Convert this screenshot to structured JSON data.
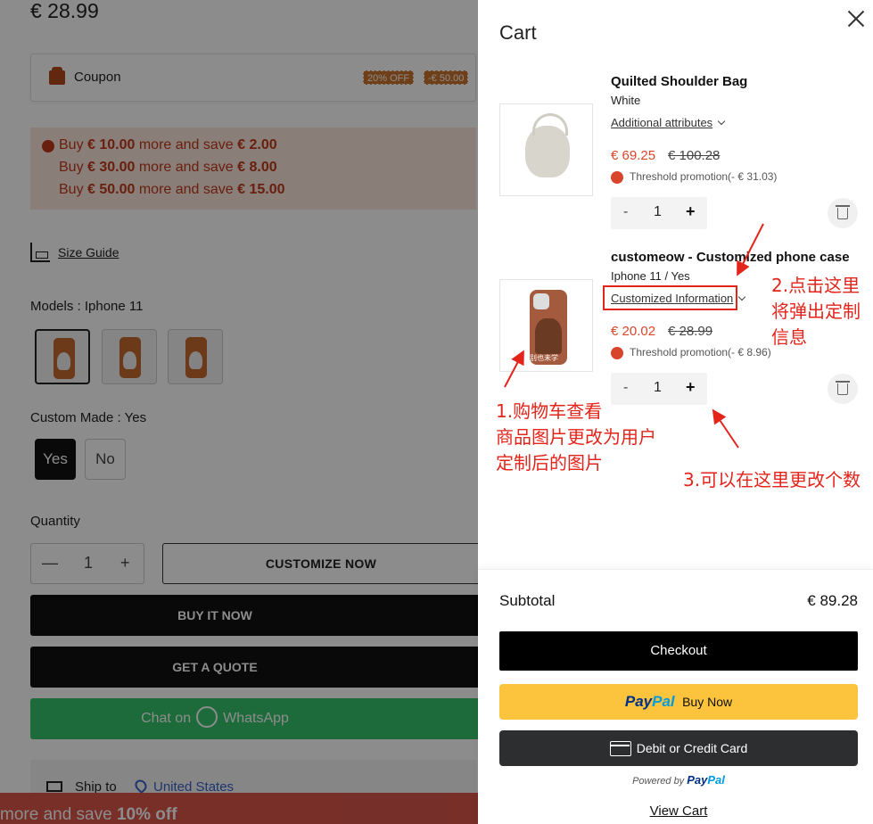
{
  "background_page": {
    "price": "€ 28.99",
    "coupon": {
      "label": "Coupon",
      "tags": [
        "20% OFF",
        "-€ 50.00"
      ]
    },
    "promotions": [
      {
        "pre": "Buy ",
        "amount": "€ 10.00",
        "mid": " more and save ",
        "save": "€ 2.00"
      },
      {
        "pre": "Buy ",
        "amount": "€ 30.00",
        "mid": " more and save ",
        "save": "€ 8.00"
      },
      {
        "pre": "Buy ",
        "amount": "€ 50.00",
        "mid": " more and save ",
        "save": "€ 15.00"
      }
    ],
    "size_guide": "Size Guide",
    "models_label": "Models : ",
    "models_value": "Iphone 11",
    "custom_made_label": "Custom Made : ",
    "custom_made_value": "Yes",
    "custom_options": [
      "Yes",
      "No"
    ],
    "quantity_label": "Quantity",
    "quantity_value": "1",
    "qty_minus": "—",
    "qty_plus": "+",
    "customize_button": "CUSTOMIZE NOW",
    "buy_button": "BUY IT NOW",
    "quote_button": "GET A QUOTE",
    "chat_prefix": "Chat on",
    "chat_app": "WhatsApp",
    "ship_to_label": "Ship to",
    "ship_to_value": "United States",
    "bottom_bar_prefix": "more and save ",
    "bottom_bar_bold": "10% off"
  },
  "cart": {
    "title": "Cart",
    "items": [
      {
        "name": "Quilted Shoulder Bag",
        "variant": "White",
        "attributes_link": "Additional attributes",
        "price": "€ 69.25",
        "original_price": "€ 100.28",
        "promotion": "Threshold promotion(- € 31.03)",
        "quantity": "1"
      },
      {
        "name": "customeow - Customized phone case",
        "variant": "Iphone 11 / Yes",
        "attributes_link": "Customized Information",
        "price": "€ 20.02",
        "original_price": "€ 28.99",
        "promotion": "Threshold promotion(- € 8.96)",
        "quantity": "1",
        "image_text": "别也未学"
      }
    ],
    "qty_minus": "-",
    "qty_plus": "+",
    "subtotal_label": "Subtotal",
    "subtotal_value": "€ 89.28",
    "checkout_button": "Checkout",
    "paypal_logo_a": "Pay",
    "paypal_logo_b": "Pal",
    "paypal_buy": "Buy Now",
    "card_button": "Debit or Credit Card",
    "powered_by": "Powered by ",
    "view_cart": "View Cart"
  },
  "annotations": {
    "note1": [
      "1.购物车查看",
      "商品图片更改为用户",
      "定制后的图片"
    ],
    "note2": [
      "2.点击这里",
      "将弹出定制",
      "信息"
    ],
    "note3": "3.可以在这里更改个数",
    "color": "#e3241b"
  }
}
